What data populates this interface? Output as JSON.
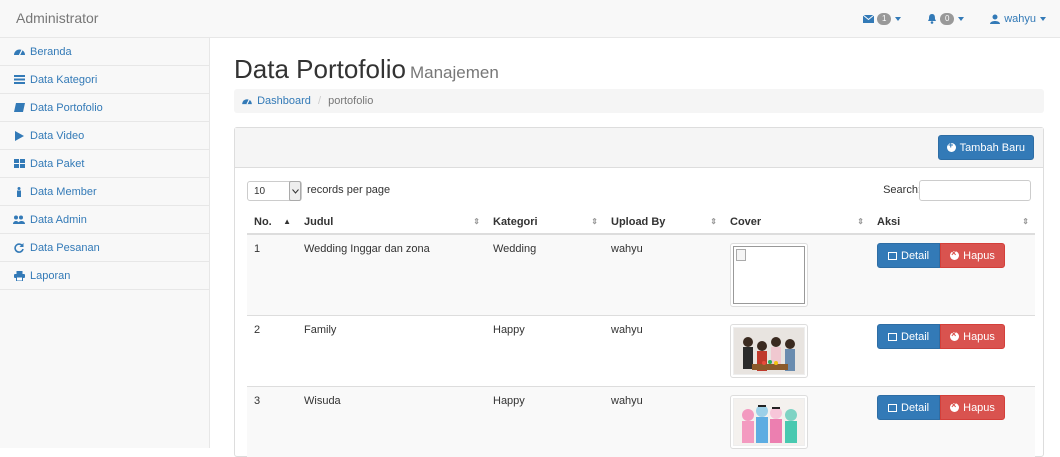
{
  "navbar": {
    "brand": "Administrator",
    "messages_count": "1",
    "alerts_count": "0",
    "user": "wahyu"
  },
  "sidebar": {
    "items": [
      {
        "label": "Beranda",
        "icon": "dashboard-icon"
      },
      {
        "label": "Data Kategori",
        "icon": "list-icon"
      },
      {
        "label": "Data Portofolio",
        "icon": "book-icon"
      },
      {
        "label": "Data Video",
        "icon": "play-icon"
      },
      {
        "label": "Data Paket",
        "icon": "th-large-icon"
      },
      {
        "label": "Data Member",
        "icon": "male-icon"
      },
      {
        "label": "Data Admin",
        "icon": "users-icon"
      },
      {
        "label": "Data Pesanan",
        "icon": "refresh-icon"
      },
      {
        "label": "Laporan",
        "icon": "print-icon"
      }
    ]
  },
  "page": {
    "title": "Data Portofolio",
    "subtitle": "Manajemen",
    "breadcrumb_home": "Dashboard",
    "breadcrumb_current": "portofolio"
  },
  "panel": {
    "add_button": "Tambah Baru",
    "records_value": "10",
    "records_label": "records per page",
    "search_label": "Search:"
  },
  "table": {
    "headers": [
      "No.",
      "Judul",
      "Kategori",
      "Upload By",
      "Cover",
      "Aksi"
    ],
    "rows": [
      {
        "no": "1",
        "judul": "Wedding Inggar dan zona",
        "kategori": "Wedding",
        "upload_by": "wahyu"
      },
      {
        "no": "2",
        "judul": "Family",
        "kategori": "Happy",
        "upload_by": "wahyu"
      },
      {
        "no": "3",
        "judul": "Wisuda",
        "kategori": "Happy",
        "upload_by": "wahyu"
      }
    ],
    "detail_label": "Detail",
    "delete_label": "Hapus"
  },
  "colors": {
    "primary": "#337ab7",
    "danger": "#d9534f"
  }
}
